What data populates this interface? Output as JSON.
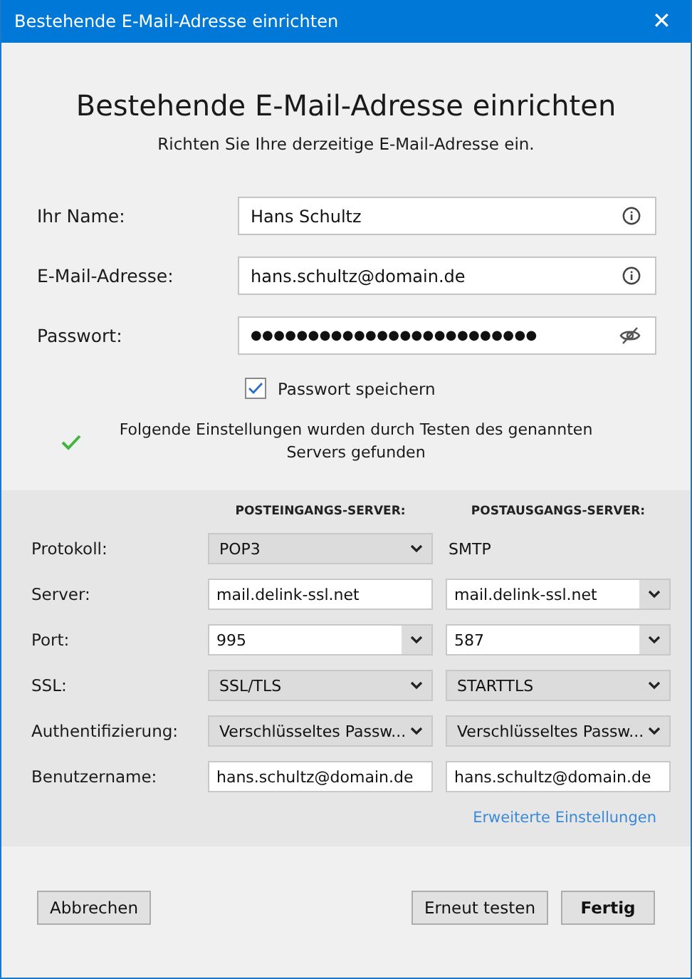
{
  "window": {
    "title": "Bestehende E-Mail-Adresse einrichten",
    "close": "✕"
  },
  "heading": "Bestehende E-Mail-Adresse einrichten",
  "subtitle": "Richten Sie Ihre derzeitige E-Mail-Adresse ein.",
  "fields": [
    {
      "label": "Ihr Name:",
      "value": "Hans Schultz",
      "kind": "info"
    },
    {
      "label": "E-Mail-Adresse:",
      "value": "hans.schultz@domain.de",
      "kind": "info"
    },
    {
      "label": "Passwort:",
      "value": "●●●●●●●●●●●●●●●●●●●●●●●●●",
      "kind": "password"
    }
  ],
  "remember_password": {
    "label": "Passwort speichern",
    "checked": true
  },
  "status": {
    "text": "Folgende Einstellungen wurden durch Testen des genannten Servers gefunden",
    "success": true
  },
  "servers": {
    "columns": [
      "POSTEINGANGS-SERVER:",
      "POSTAUSGANGS-SERVER:"
    ],
    "rows": [
      {
        "label": "Protokoll:",
        "incoming": {
          "kind": "select",
          "value": "POP3"
        },
        "outgoing": {
          "kind": "text",
          "value": "SMTP"
        }
      },
      {
        "label": "Server:",
        "incoming": {
          "kind": "input",
          "value": "mail.delink-ssl.net"
        },
        "outgoing": {
          "kind": "combo",
          "value": "mail.delink-ssl.net"
        }
      },
      {
        "label": "Port:",
        "incoming": {
          "kind": "combo",
          "value": "995"
        },
        "outgoing": {
          "kind": "combo",
          "value": "587"
        }
      },
      {
        "label": "SSL:",
        "incoming": {
          "kind": "select",
          "value": "SSL/TLS"
        },
        "outgoing": {
          "kind": "select",
          "value": "STARTTLS"
        }
      },
      {
        "label": "Authentifizierung:",
        "incoming": {
          "kind": "select",
          "value": "Verschlüsseltes Passw..."
        },
        "outgoing": {
          "kind": "select",
          "value": "Verschlüsseltes Passw..."
        }
      },
      {
        "label": "Benutzername:",
        "incoming": {
          "kind": "input",
          "value": "hans.schultz@domain.de"
        },
        "outgoing": {
          "kind": "input",
          "value": "hans.schultz@domain.de"
        }
      }
    ],
    "advanced_link": "Erweiterte Einstellungen"
  },
  "buttons": [
    {
      "label": "Abbrechen",
      "kind": "normal"
    },
    {
      "label": "Erneut testen",
      "kind": "normal"
    },
    {
      "label": "Fertig",
      "kind": "default"
    }
  ]
}
